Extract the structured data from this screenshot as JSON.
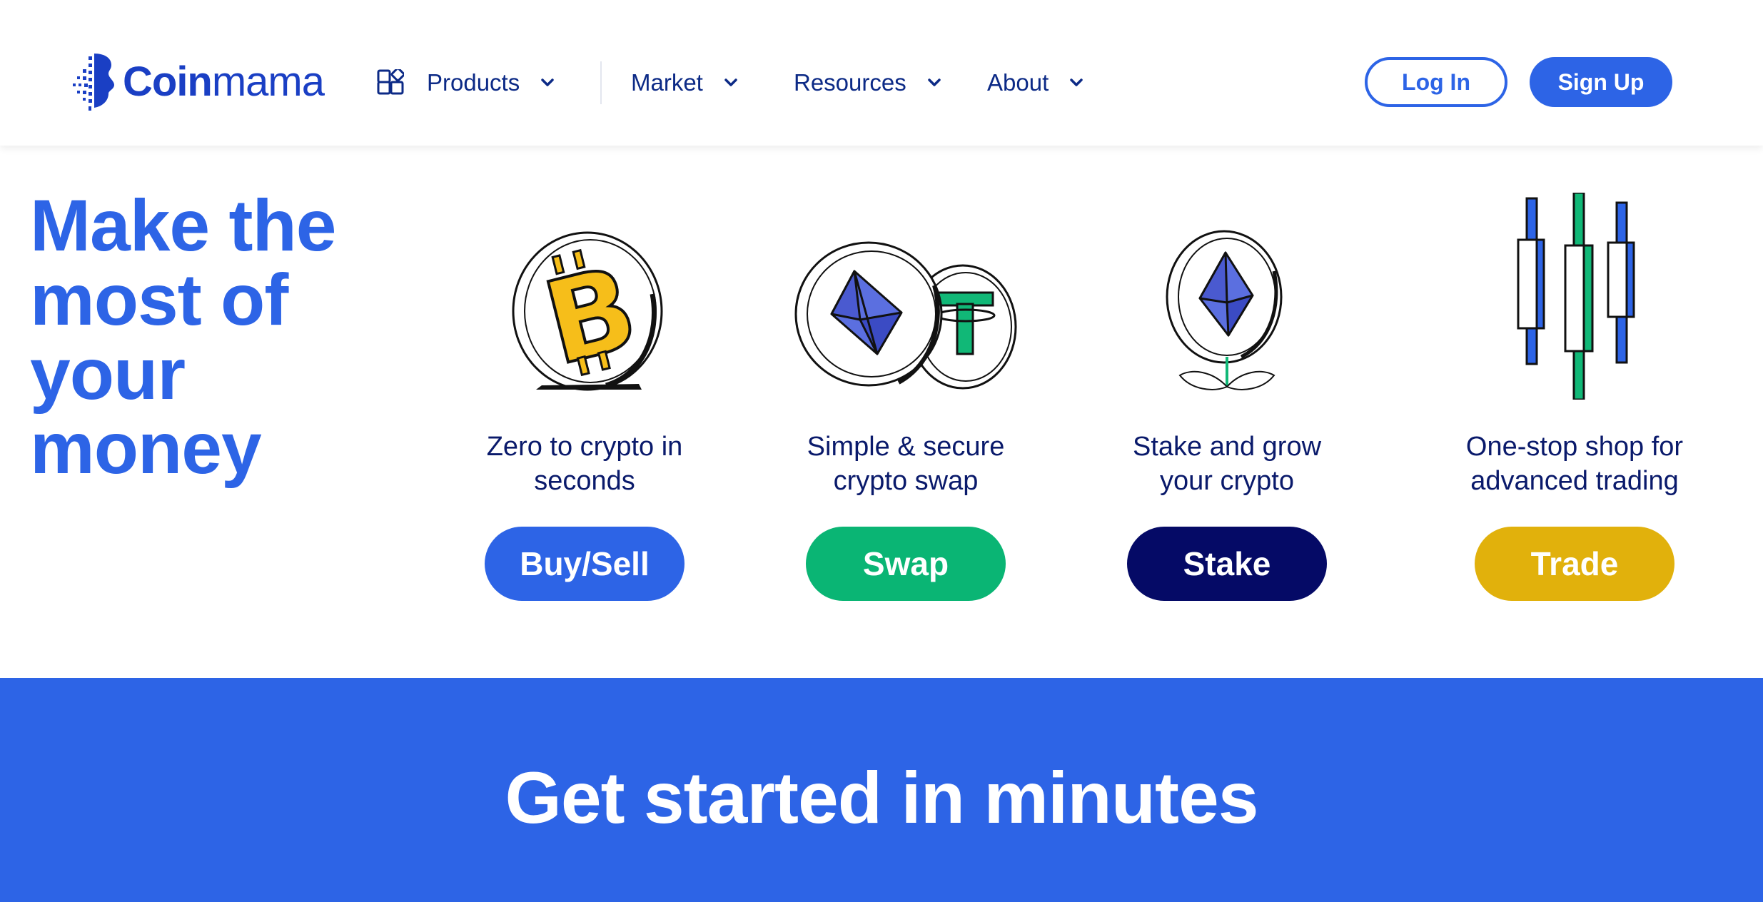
{
  "brand": {
    "name_bold": "Coin",
    "name_light": "mama",
    "accent": "#2d64e6"
  },
  "nav": {
    "products": "Products",
    "market": "Market",
    "resources": "Resources",
    "about": "About"
  },
  "auth": {
    "login": "Log In",
    "signup": "Sign Up"
  },
  "hero": {
    "title": "Make the most of your money",
    "cards": [
      {
        "desc_line1": "Zero to crypto in",
        "desc_line2": "seconds",
        "cta": "Buy/Sell",
        "color": "#2d64e6",
        "icon": "bitcoin-coin-icon"
      },
      {
        "desc_line1": "Simple & secure",
        "desc_line2": "crypto swap",
        "cta": "Swap",
        "color": "#0ab574",
        "icon": "ethereum-tether-coins-icon"
      },
      {
        "desc_line1": "Stake and grow",
        "desc_line2": "your crypto",
        "cta": "Stake",
        "color": "#050a66",
        "icon": "ethereum-plant-icon"
      },
      {
        "desc_line1": "One-stop shop for",
        "desc_line2": "advanced trading",
        "cta": "Trade",
        "color": "#e1b10c",
        "icon": "candlestick-chart-icon"
      }
    ]
  },
  "banner": {
    "title": "Get started in minutes"
  }
}
